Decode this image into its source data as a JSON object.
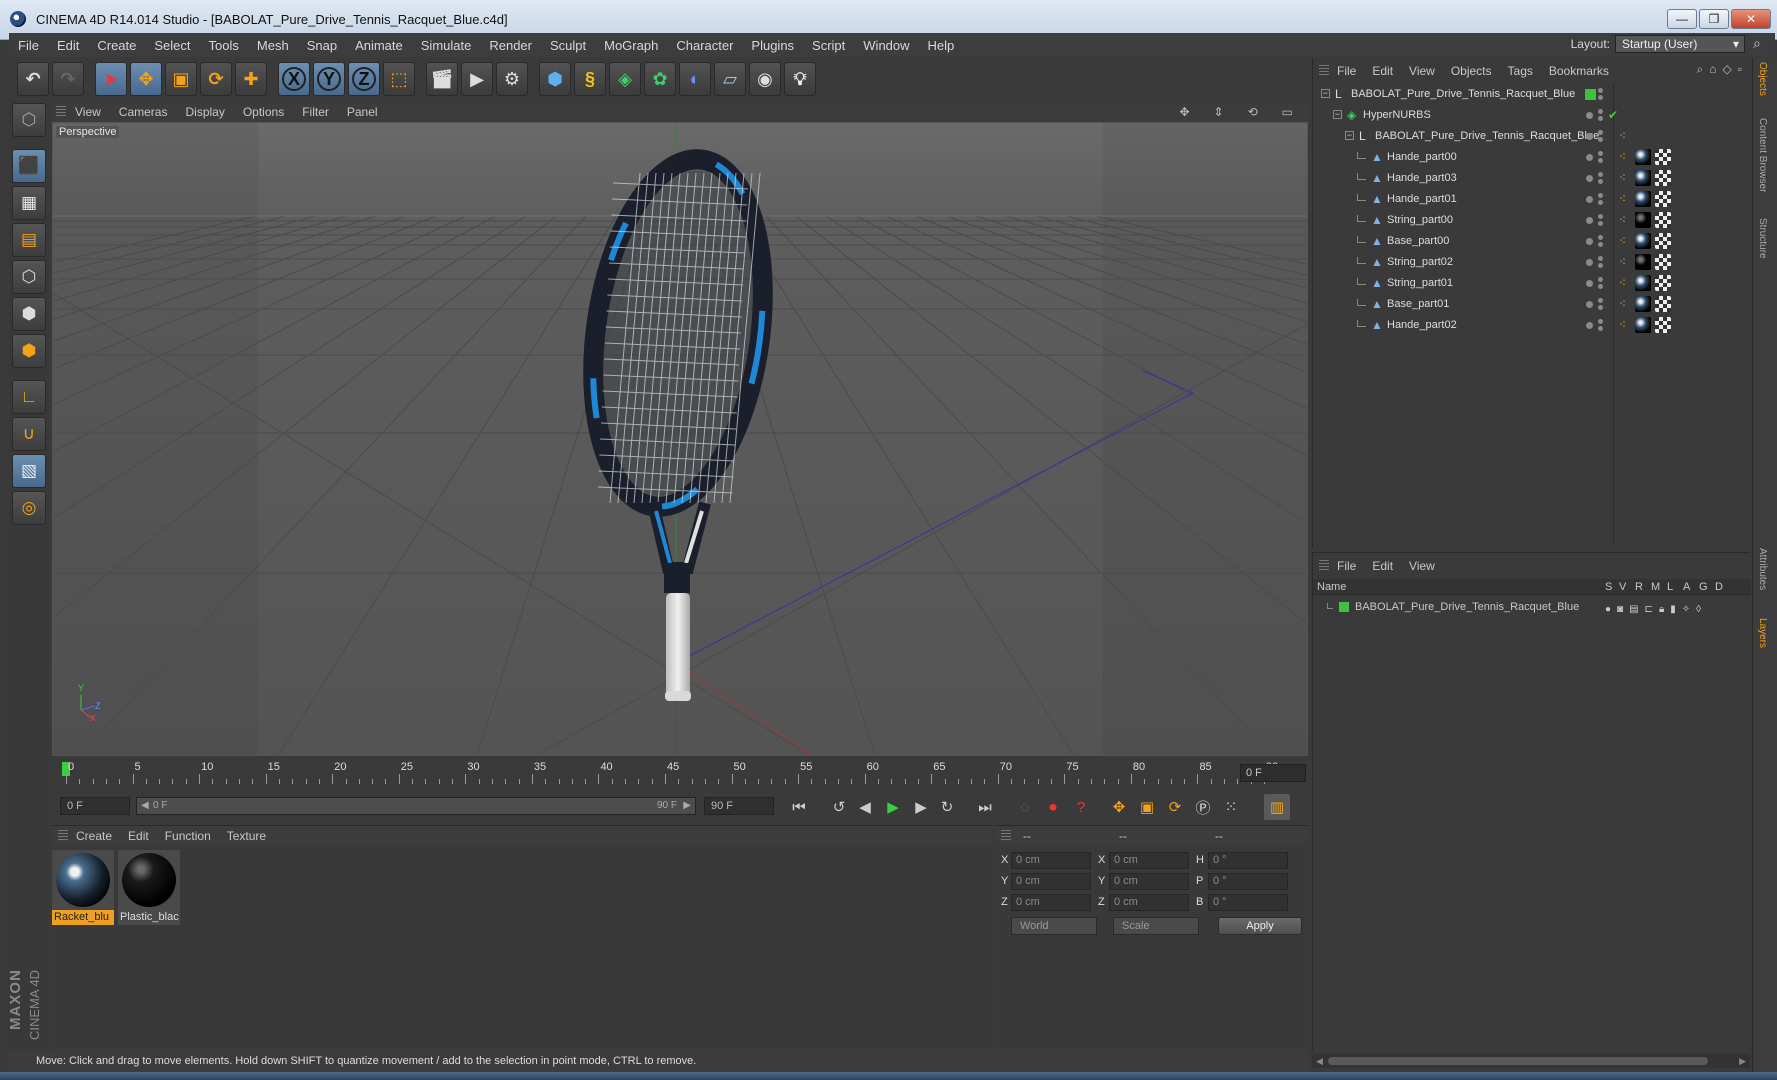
{
  "window": {
    "title": "CINEMA 4D R14.014 Studio - [BABOLAT_Pure_Drive_Tennis_Racquet_Blue.c4d]",
    "controls": [
      "—",
      "❐",
      "✕"
    ]
  },
  "menubar": {
    "items": [
      "File",
      "Edit",
      "Create",
      "Select",
      "Tools",
      "Mesh",
      "Snap",
      "Animate",
      "Simulate",
      "Render",
      "Sculpt",
      "MoGraph",
      "Character",
      "Plugins",
      "Script",
      "Window",
      "Help"
    ],
    "layout_label": "Layout:",
    "layout_value": "Startup (User)"
  },
  "toolbar": {
    "icons": [
      "undo-icon",
      "redo-icon",
      "select-live-icon",
      "move-icon",
      "scale-icon",
      "rotate-icon",
      "add-tool-icon",
      "x-axis-icon",
      "y-axis-icon",
      "z-axis-icon",
      "coordinate-system-icon",
      "render-view-icon",
      "render-picture-viewer-icon",
      "render-settings-icon",
      "cube-primitive-icon",
      "spline-icon",
      "nurbs-icon",
      "array-icon",
      "deformer-icon",
      "floor-icon",
      "camera-icon",
      "light-icon"
    ],
    "axis_labels": [
      "X",
      "Y",
      "Z"
    ]
  },
  "viewport": {
    "menu": [
      "View",
      "Cameras",
      "Display",
      "Options",
      "Filter",
      "Panel"
    ],
    "label": "Perspective",
    "axis_y": "Y",
    "axis_z": "Z",
    "axis_x": "X"
  },
  "timeline": {
    "ticks": [
      "0",
      "5",
      "10",
      "15",
      "20",
      "25",
      "30",
      "35",
      "40",
      "45",
      "50",
      "55",
      "60",
      "65",
      "70",
      "75",
      "80",
      "85",
      "90"
    ],
    "current_frame": "0 F",
    "start_field": "0 F",
    "slider_start": "0 F",
    "slider_end": "90 F",
    "end_field": "90 F"
  },
  "materials": {
    "menu": [
      "Create",
      "Edit",
      "Function",
      "Texture"
    ],
    "items": [
      {
        "name": "Racket_blu",
        "selected": true
      },
      {
        "name": "Plastic_blac",
        "selected": false
      }
    ]
  },
  "coordinates": {
    "headers": [
      "--",
      "--",
      "--"
    ],
    "rows": [
      {
        "l1": "X",
        "v1": "0 cm",
        "l2": "X",
        "v2": "0 cm",
        "l3": "H",
        "v3": "0 °"
      },
      {
        "l1": "Y",
        "v1": "0 cm",
        "l2": "Y",
        "v2": "0 cm",
        "l3": "P",
        "v3": "0 °"
      },
      {
        "l1": "Z",
        "v1": "0 cm",
        "l2": "Z",
        "v2": "0 cm",
        "l3": "B",
        "v3": "0 °"
      }
    ],
    "space_dropdown": "World",
    "mode_dropdown": "Scale",
    "apply_label": "Apply"
  },
  "objects_panel": {
    "menu": [
      "File",
      "Edit",
      "View",
      "Objects",
      "Tags",
      "Bookmarks"
    ],
    "tree": [
      {
        "name": "BABOLAT_Pure_Drive_Tennis_Racquet_Blue",
        "indent": 0,
        "kind": "null"
      },
      {
        "name": "HyperNURBS",
        "indent": 1,
        "kind": "nurbs"
      },
      {
        "name": "BABOLAT_Pure_Drive_Tennis_Racquet_Blue",
        "indent": 2,
        "kind": "null"
      },
      {
        "name": "Hande_part00",
        "indent": 3,
        "kind": "mesh"
      },
      {
        "name": "Hande_part03",
        "indent": 3,
        "kind": "mesh"
      },
      {
        "name": "Hande_part01",
        "indent": 3,
        "kind": "mesh"
      },
      {
        "name": "String_part00",
        "indent": 3,
        "kind": "mesh"
      },
      {
        "name": "Base_part00",
        "indent": 3,
        "kind": "mesh"
      },
      {
        "name": "String_part02",
        "indent": 3,
        "kind": "mesh"
      },
      {
        "name": "String_part01",
        "indent": 3,
        "kind": "mesh"
      },
      {
        "name": "Base_part01",
        "indent": 3,
        "kind": "mesh"
      },
      {
        "name": "Hande_part02",
        "indent": 3,
        "kind": "mesh"
      }
    ]
  },
  "layers_panel": {
    "menu": [
      "File",
      "Edit",
      "View"
    ],
    "columns": [
      "Name",
      "S",
      "V",
      "R",
      "M",
      "L",
      "A",
      "G",
      "D"
    ],
    "rows": [
      {
        "name": "BABOLAT_Pure_Drive_Tennis_Racquet_Blue"
      }
    ]
  },
  "side_tabs": [
    "Objects",
    "Content Browser",
    "Structure",
    "Attributes",
    "Layers"
  ],
  "status": "Move: Click and drag to move elements. Hold down SHIFT to quantize movement / add to the selection in point mode, CTRL to remove.",
  "logo": {
    "line1": "MAXON",
    "line2": "CINEMA 4D"
  },
  "colors": {
    "accent": "#f0a020",
    "layer_green": "#3cc23c",
    "viewport_bg": "#5a5a5a",
    "racket_blue": "#1e88d6"
  }
}
